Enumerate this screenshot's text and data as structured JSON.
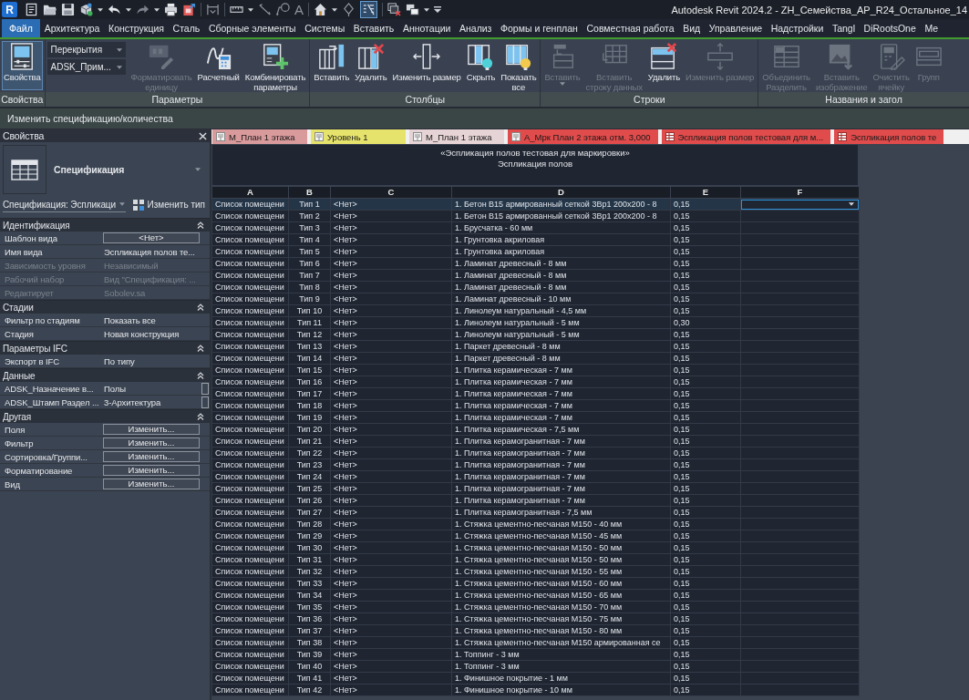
{
  "title_bar": {
    "app_logo": "R",
    "text_tool": "A",
    "thin_lines_active": true,
    "title": "Autodesk Revit 2024.2 - ZH_Семейства_АР_R24_Остальное_14"
  },
  "menu": {
    "file_button": "Файл",
    "tabs": [
      "Архитектура",
      "Конструкция",
      "Сталь",
      "Сборные элементы",
      "Системы",
      "Вставить",
      "Аннотации",
      "Анализ",
      "Формы и генплан",
      "Совместная работа",
      "Вид",
      "Управление",
      "Надстройки",
      "Tangl",
      "DiRootsOne",
      "Ме"
    ]
  },
  "ribbon": {
    "properties_panel": {
      "label": "Свойства",
      "button": {
        "label": "Свойства",
        "on": true
      }
    },
    "panels": [
      {
        "label": "Параметры",
        "dropdowns": [
          "Перекрытия",
          "ADSK_Прим..."
        ],
        "buttons": [
          {
            "label": [
              "Форматировать",
              "единицу"
            ],
            "disabled": true,
            "dropdown": false
          },
          {
            "label": [
              "Расчетный"
            ],
            "disabled": false,
            "dropdown": false
          },
          {
            "label": [
              "Комбинировать",
              "параметры"
            ],
            "disabled": false,
            "dropdown": false
          }
        ]
      },
      {
        "label": "Столбцы",
        "buttons": [
          {
            "label": [
              "Вставить"
            ],
            "disabled": false,
            "dropdown": false
          },
          {
            "label": [
              "Удалить"
            ],
            "disabled": false,
            "dropdown": false
          },
          {
            "label": [
              "Изменить размер"
            ],
            "disabled": false,
            "dropdown": false
          },
          {
            "label": [
              "Скрыть"
            ],
            "disabled": false,
            "dropdown": false
          },
          {
            "label": [
              "Показать",
              "все"
            ],
            "disabled": false,
            "dropdown": false
          }
        ]
      },
      {
        "label": "Строки",
        "buttons": [
          {
            "label": [
              "Вставить"
            ],
            "disabled": true,
            "dropdown": true
          },
          {
            "label": [
              "Вставить",
              "строку данных"
            ],
            "disabled": true,
            "dropdown": false
          },
          {
            "label": [
              "Удалить"
            ],
            "disabled": false,
            "dropdown": false
          },
          {
            "label": [
              "Изменить размер"
            ],
            "disabled": true,
            "dropdown": false
          }
        ]
      },
      {
        "label": "Названия и загол",
        "buttons": [
          {
            "label": [
              "Объединить",
              "Разделить"
            ],
            "disabled": true,
            "dropdown": false
          },
          {
            "label": [
              "Вставить",
              "изображение"
            ],
            "disabled": true,
            "dropdown": false
          },
          {
            "label": [
              "Очистить",
              "ячейку"
            ],
            "disabled": true,
            "dropdown": false
          },
          {
            "label": [
              "Групп"
            ],
            "disabled": true,
            "dropdown": false
          }
        ]
      }
    ]
  },
  "options_bar": {
    "context": "Изменить спецификацию/количества"
  },
  "properties": {
    "title": "Свойства",
    "type_name": "Спецификация",
    "instance_selector": "Спецификация: Эспликаци",
    "edit_type": "Изменить тип",
    "groups": [
      {
        "name": "Идентификация",
        "expanded": true,
        "rows": [
          {
            "label": "Шаблон вида",
            "value": "<Нет>",
            "kind": "button",
            "disabled": false
          },
          {
            "label": "Имя вида",
            "value": "Эспликация полов те...",
            "kind": "text",
            "disabled": false
          },
          {
            "label": "Зависимость уровня",
            "value": "Независимый",
            "kind": "text",
            "disabled": true
          },
          {
            "label": "Рабочий набор",
            "value": "Вид \"Спецификация: ...",
            "kind": "text",
            "disabled": true
          },
          {
            "label": "Редактирует",
            "value": "Sobolev.sa",
            "kind": "text",
            "disabled": true
          }
        ]
      },
      {
        "name": "Стадии",
        "expanded": true,
        "rows": [
          {
            "label": "Фильтр по стадиям",
            "value": "Показать все",
            "kind": "text",
            "disabled": false
          },
          {
            "label": "Стадия",
            "value": "Новая конструкция",
            "kind": "text",
            "disabled": false
          }
        ]
      },
      {
        "name": "Параметры IFC",
        "expanded": true,
        "rows": [
          {
            "label": "Экспорт в IFC",
            "value": "По типу",
            "kind": "text",
            "disabled": false
          }
        ]
      },
      {
        "name": "Данные",
        "expanded": true,
        "rows": [
          {
            "label": "ADSK_Назначение в...",
            "value": "Полы",
            "kind": "linked",
            "disabled": false
          },
          {
            "label": "ADSK_Штамп Раздел ...",
            "value": "3-Архитектура",
            "kind": "linked",
            "disabled": false
          }
        ]
      },
      {
        "name": "Другая",
        "expanded": true,
        "rows": [
          {
            "label": "Поля",
            "value": "Изменить...",
            "kind": "button",
            "disabled": false
          },
          {
            "label": "Фильтр",
            "value": "Изменить...",
            "kind": "button",
            "disabled": false
          },
          {
            "label": "Сортировка/Группи...",
            "value": "Изменить...",
            "kind": "button",
            "disabled": false
          },
          {
            "label": "Форматирование",
            "value": "Изменить...",
            "kind": "button",
            "disabled": false
          },
          {
            "label": "Вид",
            "value": "Изменить...",
            "kind": "button",
            "disabled": false
          }
        ]
      }
    ]
  },
  "view_tabs": [
    {
      "label": "М_План 1 этажа",
      "kind": "plan",
      "color": "#d99a9c"
    },
    {
      "label": "Уровень 1",
      "kind": "plan",
      "color": "#e6e36c"
    },
    {
      "label": "М_План 1 этажа",
      "kind": "plan",
      "color": "#e6d3d5"
    },
    {
      "label": "А_Мрк План 2 этажа отм. 3,000",
      "kind": "plan",
      "color": "#e04b4b"
    },
    {
      "label": "Эспликация полов тестовая для м...",
      "kind": "schedule",
      "color": "#e04b4b"
    },
    {
      "label": "Эспликация полов те",
      "kind": "schedule",
      "color": "#e04b4b"
    }
  ],
  "schedule": {
    "title": "«Эспликация полов тестовая для маркировки»",
    "subtitle": "Эспликация полов",
    "columns": [
      "A",
      "B",
      "C",
      "D",
      "E",
      "F"
    ],
    "rows": [
      {
        "cells": [
          "Список помещени",
          "Тип 1",
          "<Нет>",
          "1. Бетон В15 армированный сеткой 3Вр1 200х200 - 8",
          "0,15"
        ],
        "selected": true
      },
      {
        "cells": [
          "Список помещени",
          "Тип 2",
          "<Нет>",
          "1. Бетон В15 армированный сеткой 3Вр1 200х200 - 8",
          "0,15"
        ],
        "selected": false
      },
      {
        "cells": [
          "Список помещени",
          "Тип 3",
          "<Нет>",
          "1. Брусчатка - 60 мм",
          "0,15"
        ],
        "selected": false
      },
      {
        "cells": [
          "Список помещени",
          "Тип 4",
          "<Нет>",
          "1. Грунтовка акриловая",
          "0,15"
        ],
        "selected": false
      },
      {
        "cells": [
          "Список помещени",
          "Тип 5",
          "<Нет>",
          "1. Грунтовка акриловая",
          "0,15"
        ],
        "selected": false
      },
      {
        "cells": [
          "Список помещени",
          "Тип 6",
          "<Нет>",
          "1. Ламинат древесный - 8 мм",
          "0,15"
        ],
        "selected": false
      },
      {
        "cells": [
          "Список помещени",
          "Тип 7",
          "<Нет>",
          "1. Ламинат древесный - 8 мм",
          "0,15"
        ],
        "selected": false
      },
      {
        "cells": [
          "Список помещени",
          "Тип 8",
          "<Нет>",
          "1. Ламинат древесный - 8 мм",
          "0,15"
        ],
        "selected": false
      },
      {
        "cells": [
          "Список помещени",
          "Тип 9",
          "<Нет>",
          "1. Ламинат древесный - 10 мм",
          "0,15"
        ],
        "selected": false
      },
      {
        "cells": [
          "Список помещени",
          "Тип 10",
          "<Нет>",
          "1. Линолеум натуральный - 4,5 мм",
          "0,15"
        ],
        "selected": false
      },
      {
        "cells": [
          "Список помещени",
          "Тип 11",
          "<Нет>",
          "1. Линолеум натуральный - 5 мм",
          "0,30"
        ],
        "selected": false
      },
      {
        "cells": [
          "Список помещени",
          "Тип 12",
          "<Нет>",
          "1. Линолеум натуральный - 5 мм",
          "0,15"
        ],
        "selected": false
      },
      {
        "cells": [
          "Список помещени",
          "Тип 13",
          "<Нет>",
          "1. Паркет древесный - 8 мм",
          "0,15"
        ],
        "selected": false
      },
      {
        "cells": [
          "Список помещени",
          "Тип 14",
          "<Нет>",
          "1. Паркет древесный - 8 мм",
          "0,15"
        ],
        "selected": false
      },
      {
        "cells": [
          "Список помещени",
          "Тип 15",
          "<Нет>",
          "1. Плитка керамическая - 7 мм",
          "0,15"
        ],
        "selected": false
      },
      {
        "cells": [
          "Список помещени",
          "Тип 16",
          "<Нет>",
          "1. Плитка керамическая - 7 мм",
          "0,15"
        ],
        "selected": false
      },
      {
        "cells": [
          "Список помещени",
          "Тип 17",
          "<Нет>",
          "1. Плитка керамическая - 7 мм",
          "0,15"
        ],
        "selected": false
      },
      {
        "cells": [
          "Список помещени",
          "Тип 18",
          "<Нет>",
          "1. Плитка керамическая - 7 мм",
          "0,15"
        ],
        "selected": false
      },
      {
        "cells": [
          "Список помещени",
          "Тип 19",
          "<Нет>",
          "1. Плитка керамическая - 7 мм",
          "0,15"
        ],
        "selected": false
      },
      {
        "cells": [
          "Список помещени",
          "Тип 20",
          "<Нет>",
          "1. Плитка керамическая - 7,5 мм",
          "0,15"
        ],
        "selected": false
      },
      {
        "cells": [
          "Список помещени",
          "Тип 21",
          "<Нет>",
          "1. Плитка керамогранитная - 7 мм",
          "0,15"
        ],
        "selected": false
      },
      {
        "cells": [
          "Список помещени",
          "Тип 22",
          "<Нет>",
          "1. Плитка керамогранитная - 7 мм",
          "0,15"
        ],
        "selected": false
      },
      {
        "cells": [
          "Список помещени",
          "Тип 23",
          "<Нет>",
          "1. Плитка керамогранитная - 7 мм",
          "0,15"
        ],
        "selected": false
      },
      {
        "cells": [
          "Список помещени",
          "Тип 24",
          "<Нет>",
          "1. Плитка керамогранитная - 7 мм",
          "0,15"
        ],
        "selected": false
      },
      {
        "cells": [
          "Список помещени",
          "Тип 25",
          "<Нет>",
          "1. Плитка керамогранитная - 7 мм",
          "0,15"
        ],
        "selected": false
      },
      {
        "cells": [
          "Список помещени",
          "Тип 26",
          "<Нет>",
          "1. Плитка керамогранитная - 7 мм",
          "0,15"
        ],
        "selected": false
      },
      {
        "cells": [
          "Список помещени",
          "Тип 27",
          "<Нет>",
          "1. Плитка керамогранитная - 7,5 мм",
          "0,15"
        ],
        "selected": false
      },
      {
        "cells": [
          "Список помещени",
          "Тип 28",
          "<Нет>",
          "1. Стяжка цементно-песчаная М150 - 40 мм",
          "0,15"
        ],
        "selected": false
      },
      {
        "cells": [
          "Список помещени",
          "Тип 29",
          "<Нет>",
          "1. Стяжка цементно-песчаная М150 - 45 мм",
          "0,15"
        ],
        "selected": false
      },
      {
        "cells": [
          "Список помещени",
          "Тип 30",
          "<Нет>",
          "1. Стяжка цементно-песчаная М150 - 50 мм",
          "0,15"
        ],
        "selected": false
      },
      {
        "cells": [
          "Список помещени",
          "Тип 31",
          "<Нет>",
          "1. Стяжка цементно-песчаная М150 - 50 мм",
          "0,15"
        ],
        "selected": false
      },
      {
        "cells": [
          "Список помещени",
          "Тип 32",
          "<Нет>",
          "1. Стяжка цементно-песчаная М150 - 55 мм",
          "0,15"
        ],
        "selected": false
      },
      {
        "cells": [
          "Список помещени",
          "Тип 33",
          "<Нет>",
          "1. Стяжка цементно-песчаная М150 - 60 мм",
          "0,15"
        ],
        "selected": false
      },
      {
        "cells": [
          "Список помещени",
          "Тип 34",
          "<Нет>",
          "1. Стяжка цементно-песчаная М150 - 65 мм",
          "0,15"
        ],
        "selected": false
      },
      {
        "cells": [
          "Список помещени",
          "Тип 35",
          "<Нет>",
          "1. Стяжка цементно-песчаная М150 - 70 мм",
          "0,15"
        ],
        "selected": false
      },
      {
        "cells": [
          "Список помещени",
          "Тип 36",
          "<Нет>",
          "1. Стяжка цементно-песчаная М150 - 75 мм",
          "0,15"
        ],
        "selected": false
      },
      {
        "cells": [
          "Список помещени",
          "Тип 37",
          "<Нет>",
          "1. Стяжка цементно-песчаная М150 - 80 мм",
          "0,15"
        ],
        "selected": false
      },
      {
        "cells": [
          "Список помещени",
          "Тип 38",
          "<Нет>",
          "1. Стяжка цементно-песчаная М150 армированная се",
          "0,15"
        ],
        "selected": false
      },
      {
        "cells": [
          "Список помещени",
          "Тип 39",
          "<Нет>",
          "1. Топпинг - 3 мм",
          "0,15"
        ],
        "selected": false
      },
      {
        "cells": [
          "Список помещени",
          "Тип 40",
          "<Нет>",
          "1. Топпинг - 3 мм",
          "0,15"
        ],
        "selected": false
      },
      {
        "cells": [
          "Список помещени",
          "Тип 41",
          "<Нет>",
          "1. Финишное покрытие - 1 мм",
          "0,15"
        ],
        "selected": false
      },
      {
        "cells": [
          "Список помещени",
          "Тип 42",
          "<Нет>",
          "1. Финишное покрытие - 10 мм",
          "0,15"
        ],
        "selected": false
      }
    ]
  }
}
